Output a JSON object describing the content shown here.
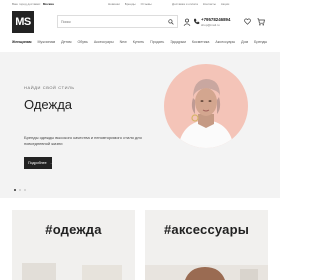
{
  "topbar": {
    "city_prefix": "Ваш город доставки:",
    "city": "Москва",
    "links": [
      "Новинки",
      "Бренды",
      "Отзывы"
    ],
    "links2": [
      "Доставка и оплата",
      "Контакты",
      "Акции"
    ]
  },
  "header": {
    "logo": "MS",
    "search_placeholder": "Поиск",
    "phone": "+79578246894",
    "email": "shop@mail.ru"
  },
  "nav": {
    "items": [
      "Женщинам",
      "Мужчинам",
      "Детям",
      "Обувь",
      "Аксессуары",
      "New",
      "Купить",
      "Продать",
      "Эдодрым",
      "Косметика",
      "Аксессуары",
      "Дом",
      "Бренды"
    ]
  },
  "hero": {
    "label": "Найди свой стиль",
    "title": "Одежда",
    "text": "Бренды одежды высокого качества и неповторимого стиля для повседневной жизни",
    "button": "Подробнее"
  },
  "categories": [
    {
      "title": "#одежда"
    },
    {
      "title": "#аксессуары"
    }
  ]
}
